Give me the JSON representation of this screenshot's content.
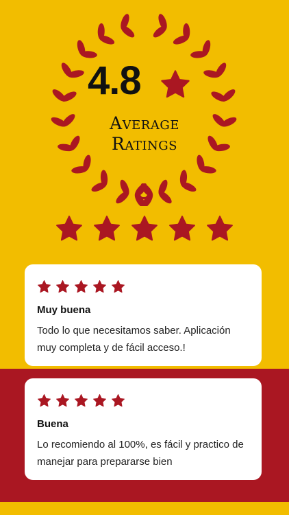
{
  "rating": {
    "value": "4.8",
    "label_line1": "Average",
    "label_line2": "Ratings"
  },
  "colors": {
    "background": "#F2BD00",
    "accent": "#AA1722",
    "text": "#111111",
    "card": "#FFFFFF"
  },
  "reviews": [
    {
      "stars": 5,
      "title": "Muy buena",
      "body": "Todo lo que necesitamos saber. Aplicación muy completa y de fácil acceso.!"
    },
    {
      "stars": 5,
      "title": "Buena",
      "body": "Lo recomiendo al 100%, es fácil y practico de manejar para prepararse bien"
    }
  ],
  "overall_stars": 5
}
